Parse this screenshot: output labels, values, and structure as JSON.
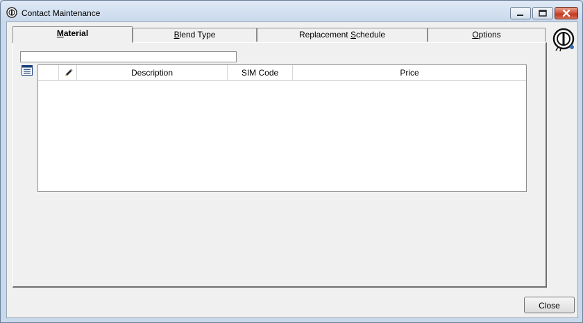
{
  "window": {
    "title": "Contact Maintenance",
    "icon": "company-logo-icon"
  },
  "titlebar_buttons": {
    "minimize": "minimize-icon",
    "maximize": "maximize-icon",
    "close": "close-icon"
  },
  "tabs": [
    {
      "key": "M",
      "rest": "aterial",
      "active": true
    },
    {
      "key": "B",
      "rest": "lend Type",
      "active": false
    },
    {
      "pre": "Replacement ",
      "key": "S",
      "rest": "chedule",
      "active": false
    },
    {
      "key": "O",
      "rest": "ptions",
      "active": false
    }
  ],
  "search": {
    "value": "",
    "placeholder": ""
  },
  "grid": {
    "row_icon": "list-icon",
    "edit_icon": "pencil-icon",
    "columns": [
      "Description",
      "SIM Code",
      "Price"
    ],
    "rows": []
  },
  "buttons": {
    "close": "Close"
  },
  "colors": {
    "title_gradient_top": "#dfe9f5",
    "client_bg": "#f0f0f0",
    "close_button_red": "#c23a22"
  }
}
